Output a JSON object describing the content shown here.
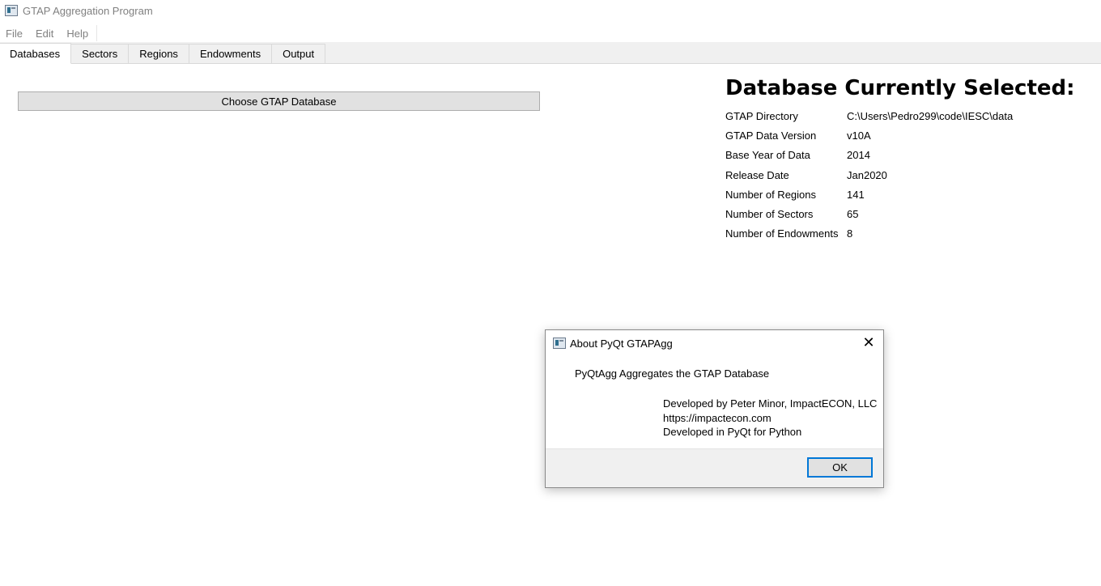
{
  "window": {
    "title": "GTAP Aggregation Program"
  },
  "menubar": {
    "items": [
      {
        "label": "File"
      },
      {
        "label": "Edit"
      },
      {
        "label": "Help"
      }
    ]
  },
  "tabs": [
    {
      "label": "Databases",
      "active": true
    },
    {
      "label": "Sectors",
      "active": false
    },
    {
      "label": "Regions",
      "active": false
    },
    {
      "label": "Endowments",
      "active": false
    },
    {
      "label": "Output",
      "active": false
    }
  ],
  "databases_tab": {
    "choose_button_label": "Choose GTAP Database",
    "heading": "Database Currently Selected:",
    "rows": [
      {
        "label": "GTAP Directory",
        "value": "C:\\Users\\Pedro299\\code\\IESC\\data"
      },
      {
        "label": "GTAP Data Version",
        "value": "v10A"
      },
      {
        "label": "Base Year of Data",
        "value": "2014"
      },
      {
        "label": "Release Date",
        "value": "Jan2020"
      },
      {
        "label": "Number of Regions",
        "value": "141"
      },
      {
        "label": "Number of Sectors",
        "value": "65"
      },
      {
        "label": "Number of Endowments",
        "value": "8"
      }
    ]
  },
  "about_dialog": {
    "title": "About PyQt GTAPAgg",
    "close_glyph": "✕",
    "main_text": "PyQtAgg Aggregates the GTAP Database",
    "detail_lines": [
      "Developed by Peter Minor, ImpactECON, LLC",
      "https://impactecon.com",
      "Developed in PyQt for Python"
    ],
    "ok_label": "OK"
  },
  "icons": {
    "app_icon": "app-window-icon",
    "close_icon": "close-icon"
  },
  "colors": {
    "focus_border": "#0078d7",
    "disabled_text": "#808080",
    "button_face": "#e1e1e1"
  }
}
